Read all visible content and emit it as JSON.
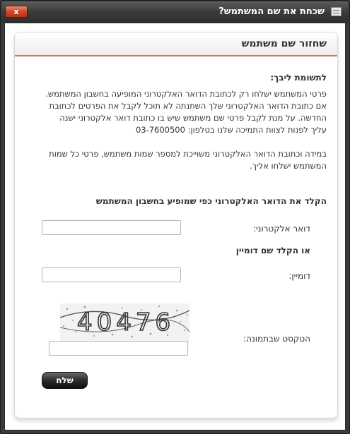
{
  "window": {
    "title": "שכחת את שם המשתמש?",
    "close_label": "x",
    "app_icon": "document-icon",
    "close_icon": "close-icon"
  },
  "panel": {
    "title": "שחזור שם משתמש",
    "attention_title": "לתשומת ליבך:",
    "paragraph1": "פרטי המשתמש ישלחו רק לכתובת הדואר האלקטרוני המופיעה בחשבון המשתמש. אם כתובת הדואר האלקטרוני שלך השתנתה לא תוכל לקבל את הפרטים לכתובת החדשה. על מנת לקבל פרטי שם משתמש שיש בו כתובת דואר אלקטרוני ישנה עליך לפנות לצוות התמיכה שלנו בטלפון: 03-7600500",
    "paragraph2": "במידה וכתובת הדואר האלקטרוני משוייכת למספר שמות משתמש, פרטי כל שמות המשתמש ישלחו אליך."
  },
  "form": {
    "section_title": "הקלד את הדואר האלקטרוני כפי שמופיע בחשבון המשתמש",
    "email_label": "דואר אלקטרוני:",
    "email_value": "",
    "or_domain_title": "או הקלד שם דומיין",
    "domain_label": "דומיין:",
    "domain_value": "",
    "captcha_text": "40476",
    "captcha_label": "הטקסט שבתמונה:",
    "captcha_value": "",
    "submit_label": "שלח"
  },
  "colors": {
    "accent": "#e07526",
    "window_frame": "#3a3a3a",
    "close_button": "#c9482a"
  }
}
